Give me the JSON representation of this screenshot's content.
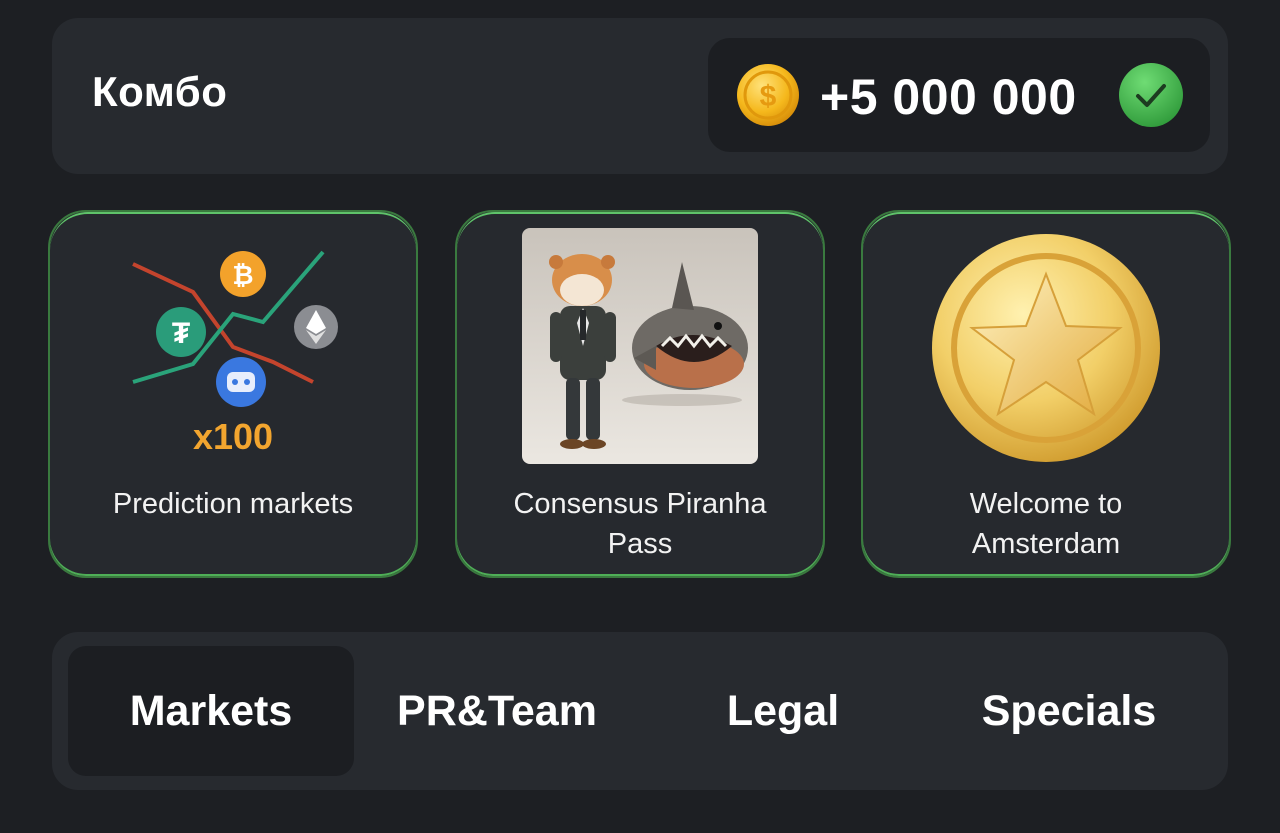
{
  "combo": {
    "title": "Комбо",
    "reward_amount": "+5 000 000",
    "coin_icon": "dollar-coin-icon",
    "check_icon": "check-circle-icon",
    "accent_color": "#4caf50"
  },
  "cards": [
    {
      "label": "Prediction markets",
      "badge": "x100",
      "icon": "crypto-chart-icon"
    },
    {
      "label_line1": "Consensus Piranha",
      "label_line2": "Pass",
      "icon": "hamster-piranha-image"
    },
    {
      "label_line1": "Welcome to",
      "label_line2": "Amsterdam",
      "icon": "gold-star-coin-icon"
    }
  ],
  "tabs": [
    {
      "label": "Markets",
      "active": true
    },
    {
      "label": "PR&Team",
      "active": false
    },
    {
      "label": "Legal",
      "active": false
    },
    {
      "label": "Specials",
      "active": false
    }
  ]
}
